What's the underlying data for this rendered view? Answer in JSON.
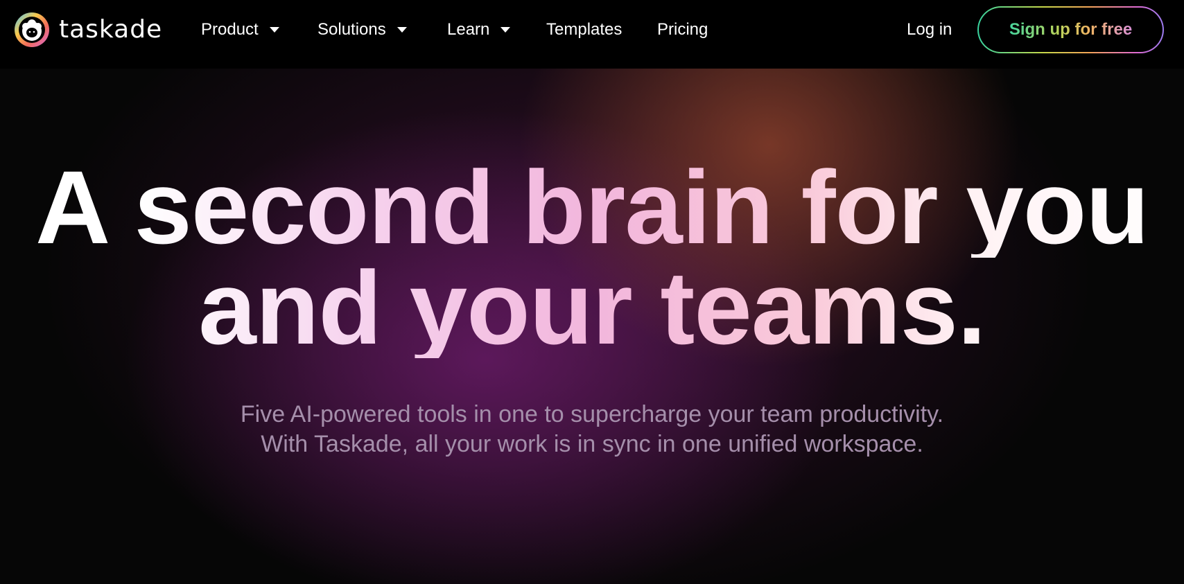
{
  "brand": {
    "name": "taskade"
  },
  "nav": {
    "items": [
      {
        "label": "Product",
        "has_dropdown": true
      },
      {
        "label": "Solutions",
        "has_dropdown": true
      },
      {
        "label": "Learn",
        "has_dropdown": true
      },
      {
        "label": "Templates",
        "has_dropdown": false
      },
      {
        "label": "Pricing",
        "has_dropdown": false
      }
    ],
    "login_label": "Log in",
    "signup_label": "Sign up for free"
  },
  "hero": {
    "headline_line1": "A second brain for you",
    "headline_line2": "and your teams.",
    "subtitle_line1": "Five AI-powered tools in one to supercharge your team productivity.",
    "subtitle_line2": "With Taskade, all your work is in sync in one unified workspace."
  },
  "colors": {
    "background": "#000000",
    "text": "#ffffff",
    "subtitle": "#a58fab",
    "glow_orange": "#96462d",
    "glow_purple": "#6e1c6e"
  },
  "icons": {
    "logo": "taskade-sheep-logo-icon",
    "dropdown": "chevron-down-icon"
  }
}
